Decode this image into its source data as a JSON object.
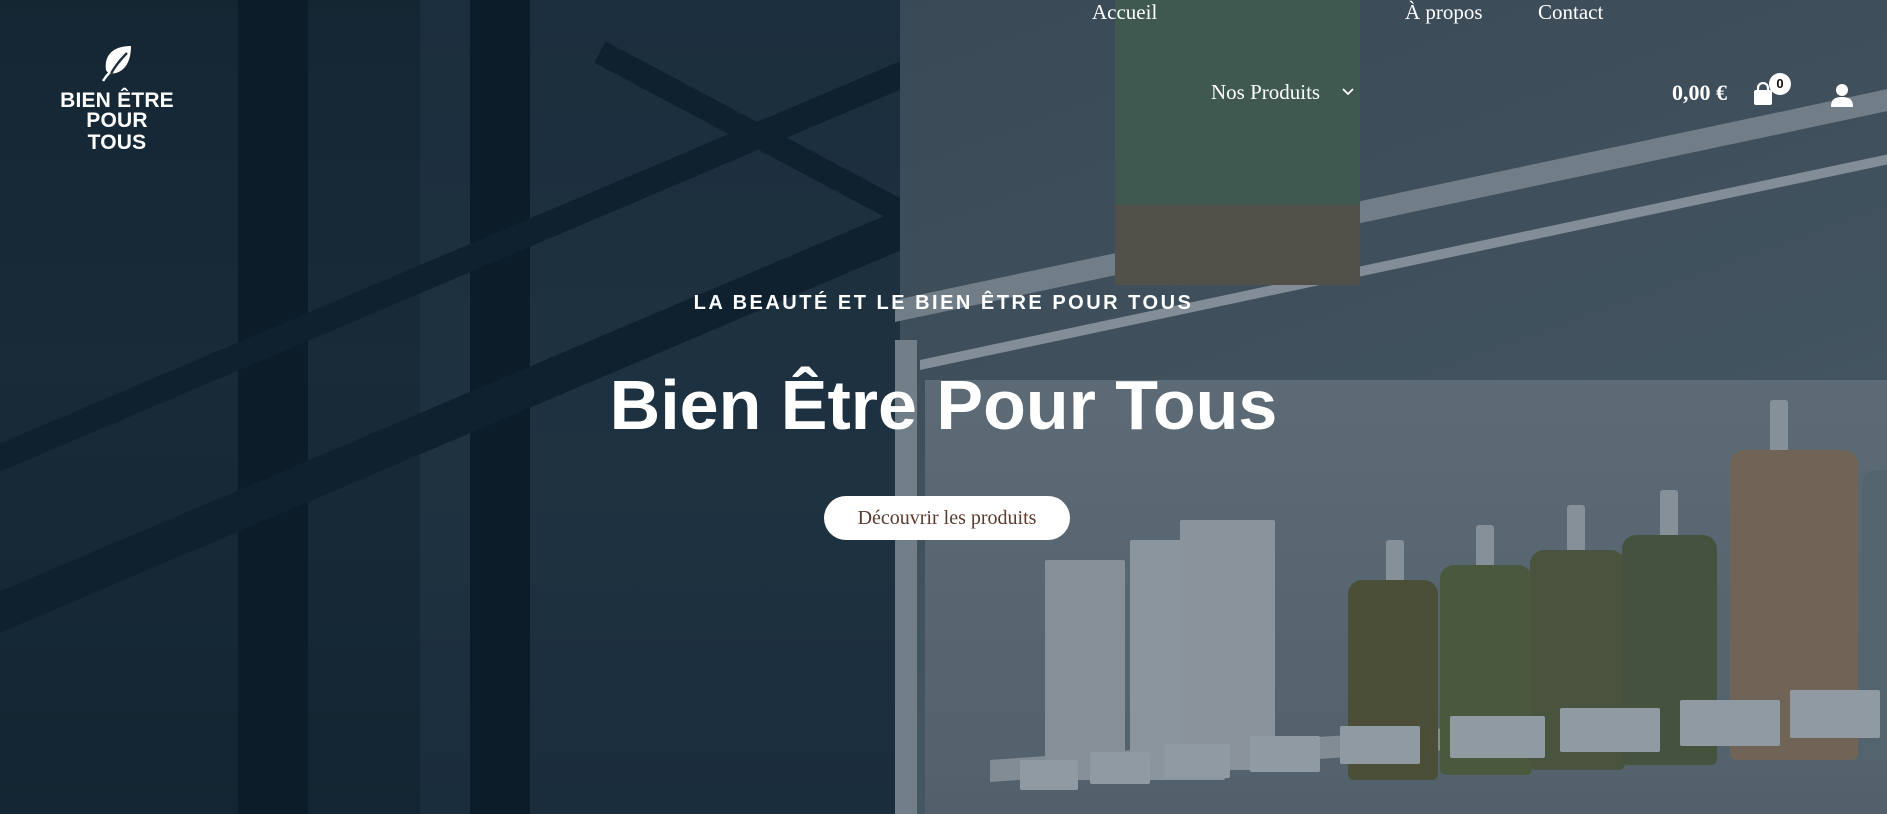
{
  "brand": {
    "logo_line1": "BIEN ÊTRE",
    "logo_line2": "POUR TOUS",
    "logo_icon": "leaf-icon"
  },
  "nav": {
    "items": [
      {
        "label": "Accueil"
      },
      {
        "label": "Nos Produits",
        "has_dropdown": true
      },
      {
        "label": "À propos"
      },
      {
        "label": "Contact"
      }
    ]
  },
  "cart": {
    "total": "0,00 €",
    "count": "0",
    "icon": "shopping-bag-icon"
  },
  "account": {
    "icon": "user-icon"
  },
  "hero": {
    "eyebrow": "LA BEAUTÉ ET LE BIEN ÊTRE POUR TOUS",
    "title": "Bien Être Pour Tous",
    "cta_label": "Découvrir les produits"
  },
  "colors": {
    "text": "#ffffff",
    "cta_background": "#ffffff",
    "cta_text": "#5a3b2e",
    "overlay": "#0a1e2d"
  }
}
